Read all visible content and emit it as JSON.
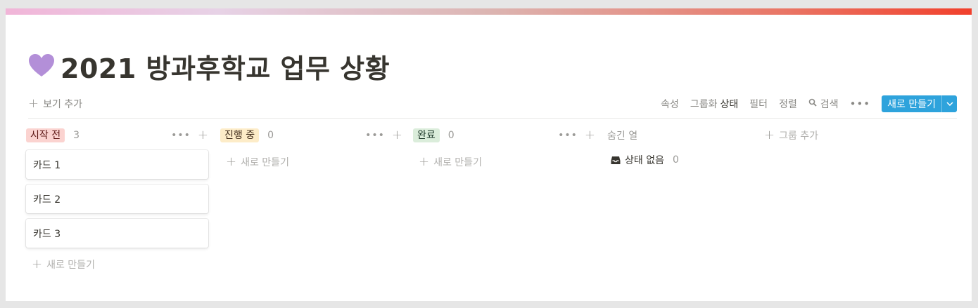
{
  "page": {
    "title": "2021 방과후학교 업무 상황",
    "title_icon": "purple-heart-icon"
  },
  "toolbar": {
    "add_view": "보기 추가",
    "properties": "속성",
    "group_by": "그룹화",
    "group_by_value": "상태",
    "filter": "필터",
    "sort": "정렬",
    "search": "검색",
    "more": "•••",
    "new_button": "새로 만들기",
    "new_button_arrow": "⌄"
  },
  "board": {
    "columns": [
      {
        "label": "시작 전",
        "count": "3",
        "tag_bg": "#fbd3d0",
        "tag_fg": "#5d1715",
        "cards": [
          "카드 1",
          "카드 2",
          "카드 3"
        ],
        "new_label": "새로 만들기"
      },
      {
        "label": "진행 중",
        "count": "0",
        "tag_bg": "#fdecc8",
        "tag_fg": "#402c1b",
        "cards": [],
        "new_label": "새로 만들기"
      },
      {
        "label": "완료",
        "count": "0",
        "tag_bg": "#dbeddb",
        "tag_fg": "#1c3829",
        "cards": [],
        "new_label": "새로 만들기"
      }
    ],
    "hidden": {
      "title": "숨긴 열",
      "no_status_label": "상태 없음",
      "no_status_count": "0"
    },
    "add_group": "그룹 추가"
  },
  "colors": {
    "accent": "#2ea3dc",
    "heart": "#b38fd8"
  }
}
